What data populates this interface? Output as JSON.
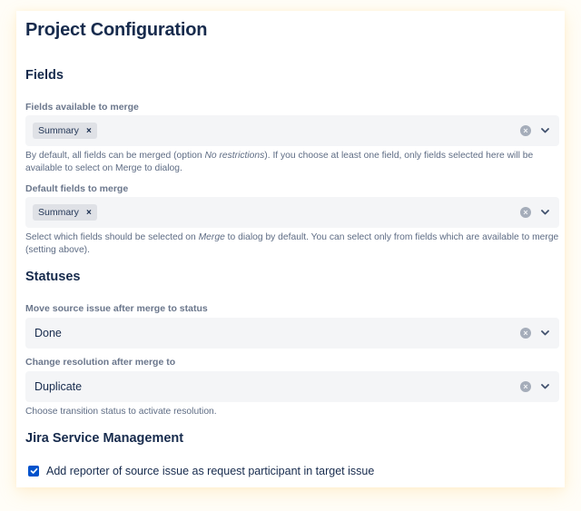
{
  "page": {
    "title": "Project Configuration"
  },
  "fields_section": {
    "heading": "Fields",
    "available": {
      "label": "Fields available to merge",
      "selected": [
        {
          "label": "Summary"
        }
      ],
      "help_before": "By default, all fields can be merged (option ",
      "help_em": "No restrictions",
      "help_after": "). If you choose at least one field, only fields selected here will be available to select on Merge to dialog."
    },
    "default": {
      "label": "Default fields to merge",
      "selected": [
        {
          "label": "Summary"
        }
      ],
      "help_before": "Select which fields should be selected on ",
      "help_em": "Merge",
      "help_after": " to dialog by default. You can select only from fields which are available to merge (setting above)."
    }
  },
  "statuses_section": {
    "heading": "Statuses",
    "move_status": {
      "label": "Move source issue after merge to status",
      "value": "Done"
    },
    "resolution": {
      "label": "Change resolution after merge to",
      "value": "Duplicate",
      "help": "Choose transition status to activate resolution."
    }
  },
  "jsm_section": {
    "heading": "Jira Service Management",
    "add_reporter": {
      "label": "Add reporter of source issue as request participant in target issue",
      "checked": true
    }
  },
  "icons": {
    "chip_remove": "×",
    "clear": "×"
  },
  "colors": {
    "accent": "#0052cc",
    "field_bg": "#f4f5f7",
    "chip_bg": "#dfe1e6",
    "text": "#172b4d",
    "subtle_text": "#6b778c"
  }
}
